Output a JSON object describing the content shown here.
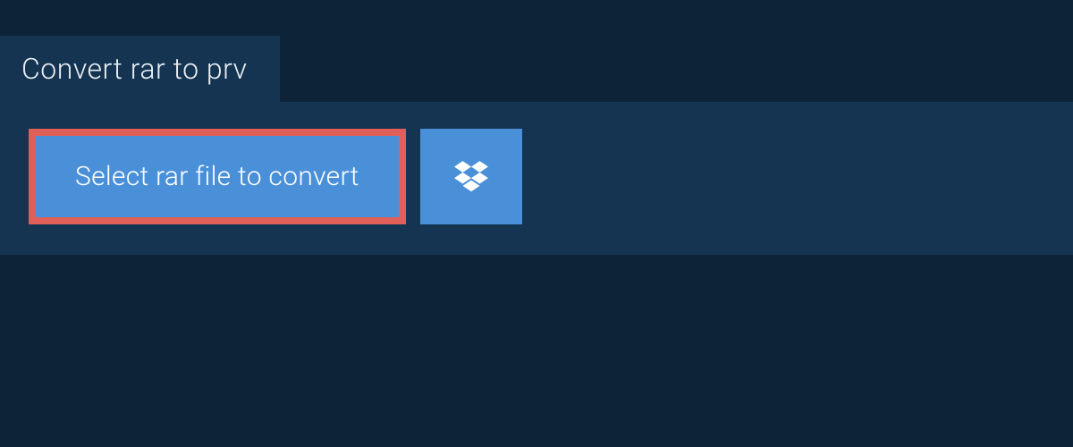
{
  "tab": {
    "title": "Convert rar to prv"
  },
  "actions": {
    "select_label": "Select rar file to convert"
  },
  "colors": {
    "page_bg": "#0d2438",
    "panel_bg": "#153451",
    "button_bg": "#4a90d9",
    "highlight_border": "#e06059",
    "text_light": "#ffffff"
  }
}
